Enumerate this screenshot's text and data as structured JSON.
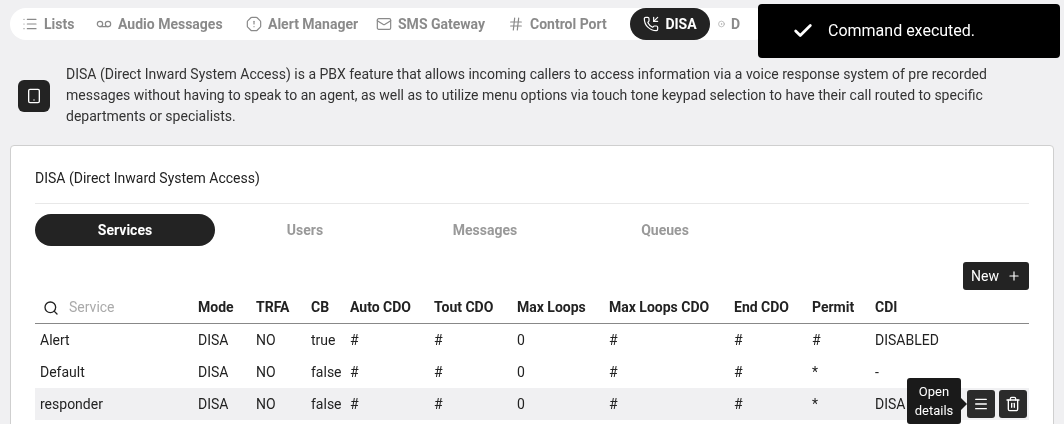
{
  "nav_tabs": [
    {
      "label": "Lists",
      "selected": false
    },
    {
      "label": "Audio Messages",
      "selected": false
    },
    {
      "label": "Alert Manager",
      "selected": false
    },
    {
      "label": "SMS Gateway",
      "selected": false
    },
    {
      "label": "Control Port",
      "selected": false
    },
    {
      "label": "DISA",
      "selected": true
    },
    {
      "label": "D",
      "selected": false
    }
  ],
  "toast": {
    "message": "Command executed."
  },
  "description": "DISA (Direct Inward System Access) is a PBX feature that allows incoming callers to access information via a voice response system of pre recorded messages without having to speak to an agent, as well as to utilize menu options via touch tone keypad selection to have their call routed to specific departments or specialists.",
  "card": {
    "title": "DISA (Direct Inward System Access)",
    "tabs": [
      {
        "label": "Services",
        "selected": true
      },
      {
        "label": "Users",
        "selected": false
      },
      {
        "label": "Messages",
        "selected": false
      },
      {
        "label": "Queues",
        "selected": false
      }
    ],
    "new_button": "New",
    "table": {
      "columns": [
        {
          "kind": "search",
          "placeholder": "Service"
        },
        {
          "kind": "text",
          "label": "Mode"
        },
        {
          "kind": "text",
          "label": "TRFA"
        },
        {
          "kind": "text",
          "label": "CB"
        },
        {
          "kind": "text",
          "label": "Auto CDO"
        },
        {
          "kind": "text",
          "label": "Tout CDO"
        },
        {
          "kind": "text",
          "label": "Max Loops"
        },
        {
          "kind": "text",
          "label": "Max Loops CDO"
        },
        {
          "kind": "text",
          "label": "End CDO"
        },
        {
          "kind": "text",
          "label": "Permit"
        },
        {
          "kind": "text",
          "label": "CDI"
        }
      ],
      "rows": [
        {
          "cells": [
            "Alert",
            "DISA",
            "NO",
            "true",
            "#",
            "#",
            "0",
            "#",
            "#",
            "#",
            "DISABLED"
          ],
          "hovered": false
        },
        {
          "cells": [
            "Default",
            "DISA",
            "NO",
            "false",
            "#",
            "#",
            "0",
            "#",
            "#",
            "*",
            "-"
          ],
          "hovered": false
        },
        {
          "cells": [
            "responder",
            "DISA",
            "NO",
            "false",
            "#",
            "#",
            "0",
            "#",
            "#",
            "*",
            "DISA"
          ],
          "hovered": true,
          "tooltip": "Open details"
        }
      ]
    }
  }
}
